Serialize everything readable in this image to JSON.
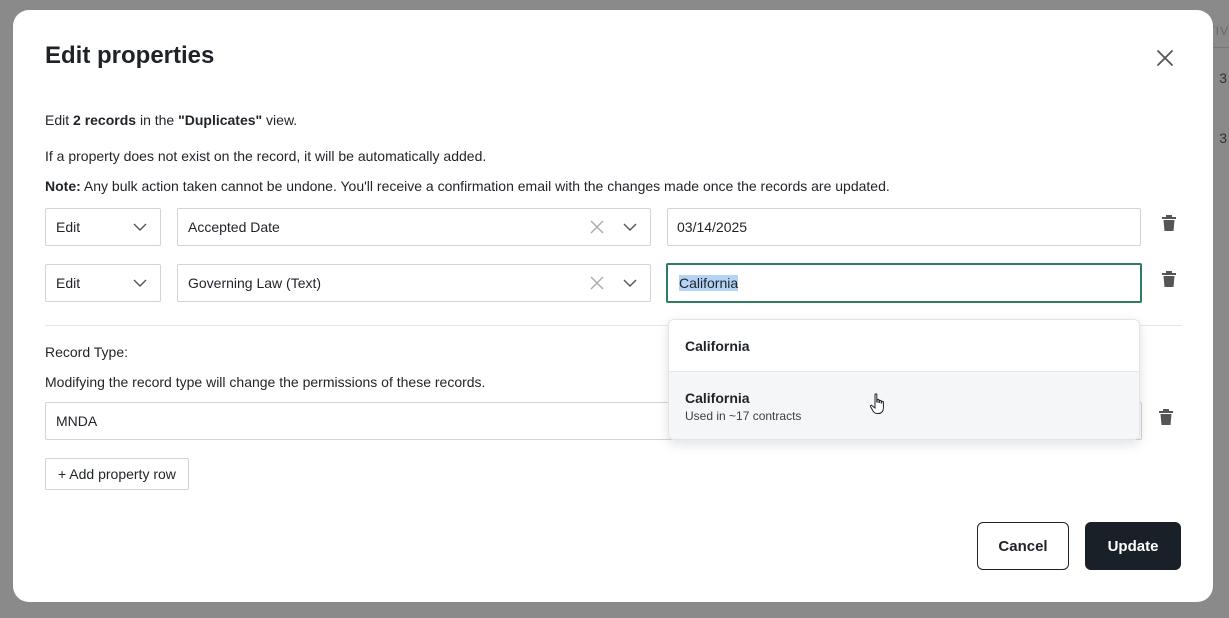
{
  "backdrop": {
    "column_header": "TIV",
    "values": [
      "3",
      "3"
    ]
  },
  "modal": {
    "title": "Edit properties",
    "intro": {
      "prefix": "Edit ",
      "count": "2 records",
      "middle": " in the ",
      "view": "\"Duplicates\"",
      "suffix": " view."
    },
    "auto_add_note": "If a property does not exist on the record, it will be automatically added.",
    "note": {
      "label": "Note:",
      "text": " Any bulk action taken cannot be undone. You'll receive a confirmation email with the changes made once the records are updated."
    },
    "rows": [
      {
        "action": "Edit",
        "property": "Accepted Date",
        "value": "03/14/2025"
      },
      {
        "action": "Edit",
        "property": "Governing Law (Text)",
        "value": "California"
      }
    ],
    "record_type": {
      "label": "Record Type:",
      "description": "Modifying the record type will change the permissions of these records.",
      "value": "MNDA"
    },
    "add_row_label": "+ Add property row",
    "cancel_label": "Cancel",
    "update_label": "Update"
  },
  "dropdown": {
    "options": [
      {
        "label": "California"
      },
      {
        "label": "California",
        "sublabel": "Used in ~17 contracts"
      }
    ]
  },
  "colors": {
    "focus_border": "#2e7d5b",
    "primary_button": "#1a2028",
    "selection": "#b4d3f5"
  }
}
